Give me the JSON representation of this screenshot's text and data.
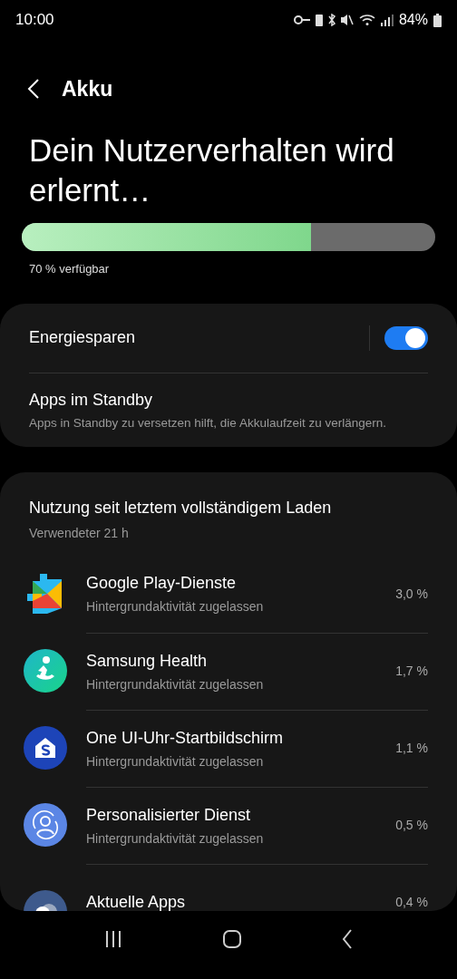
{
  "status_bar": {
    "time": "10:00",
    "battery": "84%"
  },
  "header": {
    "title": "Akku"
  },
  "headline": "Dein Nutzerverhalten wird erlernt…",
  "battery_bar": {
    "level": 0.7,
    "label": "70 % verfügbar"
  },
  "settings": [
    {
      "kind": "toggle",
      "label": "Energiesparen",
      "on": true
    },
    {
      "kind": "link",
      "label": "Apps im Standby",
      "description": "Apps in Standby zu versetzen hilft, die Akkulaufzeit zu verlängern."
    }
  ],
  "usage": {
    "title": "Nutzung seit letztem vollständigem Laden",
    "subtitle": "Verwendeter 21 h",
    "apps": [
      {
        "name": "Google Play-Dienste",
        "status": "Hintergrundaktivität zugelassen",
        "percent": "3,0 %"
      },
      {
        "name": "Samsung Health",
        "status": "Hintergrundaktivität zugelassen",
        "percent": "1,7 %"
      },
      {
        "name": "One UI-Uhr-Startbildschirm",
        "status": "Hintergrundaktivität zugelassen",
        "percent": "1,1 %"
      },
      {
        "name": "Personalisierter Dienst",
        "status": "Hintergrundaktivität zugelassen",
        "percent": "0,5 %"
      },
      {
        "name": "Aktuelle Apps",
        "percent": "0,4 %"
      }
    ]
  }
}
